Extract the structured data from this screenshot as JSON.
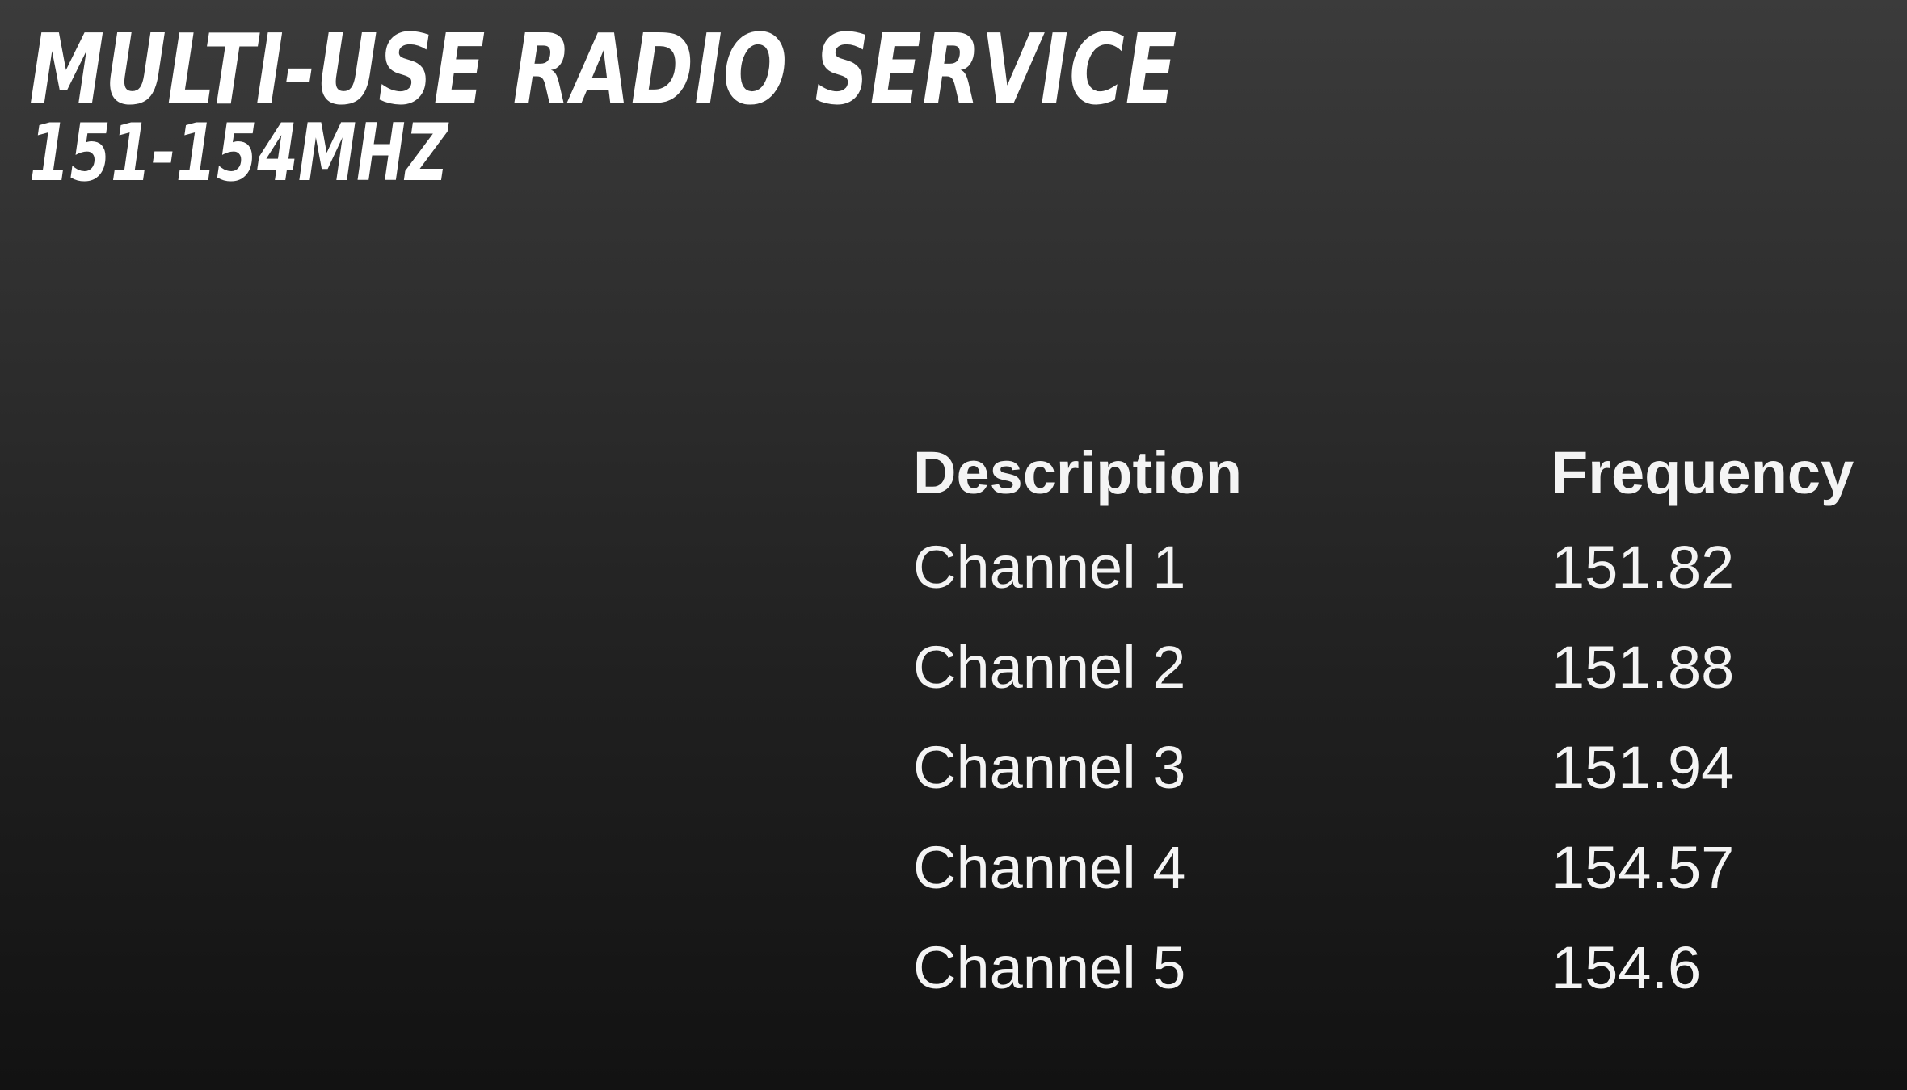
{
  "slide": {
    "title": "MULTI-USE RADIO SERVICE",
    "subtitle": "151-154MHZ"
  },
  "table": {
    "headers": [
      "Description",
      "Frequency"
    ],
    "rows": [
      {
        "description": "Channel 1",
        "frequency": "151.82"
      },
      {
        "description": "Channel 2",
        "frequency": "151.88"
      },
      {
        "description": "Channel 3",
        "frequency": "151.94"
      },
      {
        "description": "Channel 4",
        "frequency": "154.57"
      },
      {
        "description": "Channel 5",
        "frequency": "154.6"
      }
    ]
  },
  "colors": {
    "background_top": "#3b3b3b",
    "background_bottom": "#121212",
    "text": "#ffffff"
  }
}
